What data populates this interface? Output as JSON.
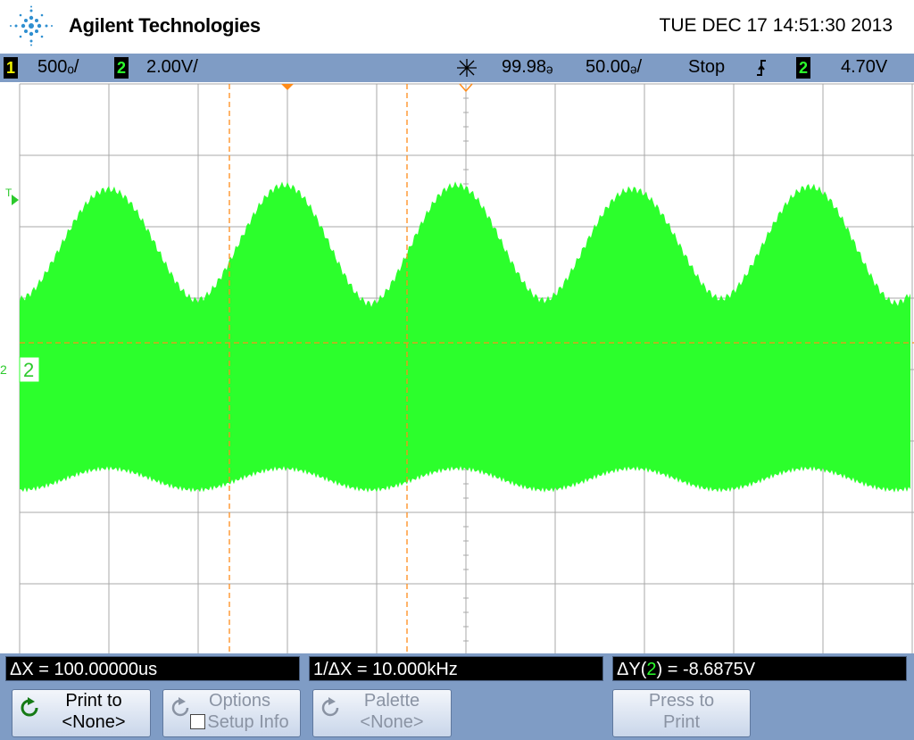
{
  "header": {
    "brand": "Agilent Technologies",
    "datetime": "TUE DEC 17 14:51:30 2013"
  },
  "status": {
    "ch1_label": "1",
    "ch1_scale": "500ₒ/",
    "ch2_label": "2",
    "ch2_scale": "2.00V/",
    "time_delay": "99.98ₔ",
    "time_scale": "50.00ₔ/",
    "run_state": "Stop",
    "trigger_source": "2",
    "trigger_level": "4.70V"
  },
  "screen": {
    "trigger_marker": "T",
    "channel_marker": "2",
    "ground_marker": "2",
    "trace_color": "#2cff2c",
    "cursor_color": "#ff8c1a"
  },
  "readouts": {
    "delta_x": "ΔX = 100.00000us",
    "inv_delta_x": "1/ΔX = 10.000kHz",
    "delta_y_prefix": "ΔY(",
    "delta_y_channel": "2",
    "delta_y_suffix": ") = -8.6875V"
  },
  "softkeys": {
    "print_line1": "Print to",
    "print_line2": "<None>",
    "options_line1": "Options",
    "options_line2": "Setup Info",
    "palette_line1": "Palette",
    "palette_line2": "<None>",
    "press_line1": "Press to",
    "press_line2": "Print"
  }
}
